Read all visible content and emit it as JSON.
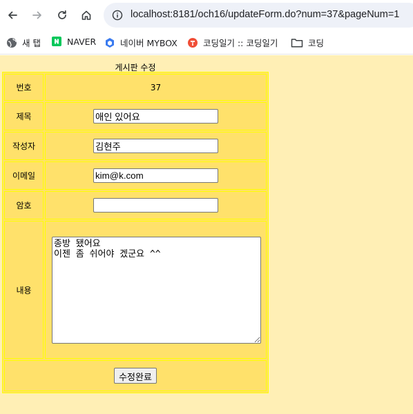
{
  "browser": {
    "url": "localhost:8181/och16/updateForm.do?num=37&pageNum=1",
    "bookmarks": [
      {
        "label": "새 탭",
        "icon": "globe-icon"
      },
      {
        "label": "NAVER",
        "icon": "naver-icon"
      },
      {
        "label": "네이버 MYBOX",
        "icon": "mybox-icon"
      },
      {
        "label": "코딩일기 :: 코딩일기",
        "icon": "tistory-icon"
      },
      {
        "label": "코딩",
        "icon": "folder-icon"
      }
    ]
  },
  "form": {
    "caption": "게시판 수정",
    "num_label": "번호",
    "num_value": "37",
    "subject_label": "제목",
    "subject_value": "애인 있어요",
    "writer_label": "작성자",
    "writer_value": "김현주",
    "email_label": "이메일",
    "email_value": "kim@k.com",
    "password_label": "암호",
    "password_value": "",
    "content_label": "내용",
    "content_value": "종방 됐어요\n이젠 좀 쉬어야 겠군요 ^^",
    "submit_label": "수정완료"
  },
  "colors": {
    "page_background": "#ffefb5",
    "table_background": "#ffe16b",
    "table_border": "#ffff00"
  }
}
